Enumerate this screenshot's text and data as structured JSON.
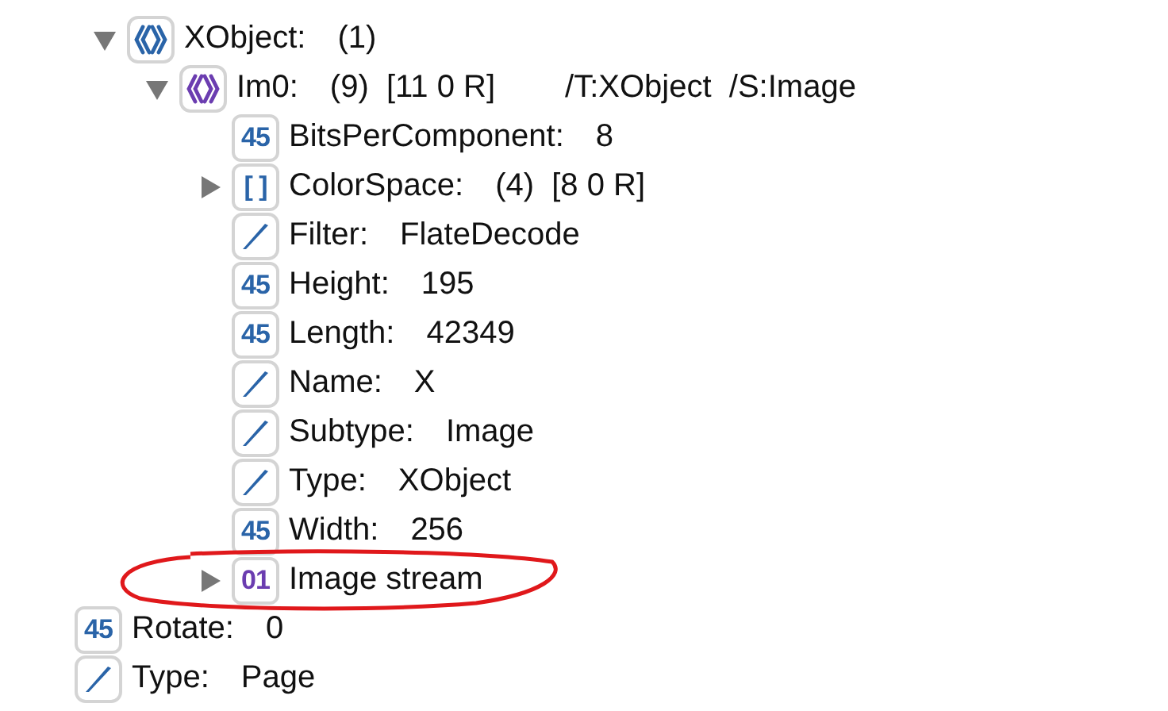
{
  "tree": [
    {
      "kind": "continuation",
      "children": [
        {
          "kind": "dict",
          "key": "XObject:",
          "value": "(1)",
          "expanded": true,
          "children": [
            {
              "kind": "stream-dict",
              "key": "Im0:",
              "value": "(9)  [11 0 R]",
              "extra": "/T:XObject  /S:Image",
              "expanded": true,
              "children": [
                {
                  "kind": "number",
                  "icon_text": "45",
                  "key": "BitsPerComponent:",
                  "value": "8"
                },
                {
                  "kind": "array",
                  "icon_text": "[ ]",
                  "key": "ColorSpace:",
                  "value": "(4)  [8 0 R]",
                  "expanded": false
                },
                {
                  "kind": "name",
                  "key": "Filter:",
                  "value": "FlateDecode"
                },
                {
                  "kind": "number",
                  "icon_text": "45",
                  "key": "Height:",
                  "value": "195"
                },
                {
                  "kind": "number",
                  "icon_text": "45",
                  "key": "Length:",
                  "value": "42349"
                },
                {
                  "kind": "name",
                  "key": "Name:",
                  "value": "X"
                },
                {
                  "kind": "name",
                  "key": "Subtype:",
                  "value": "Image"
                },
                {
                  "kind": "name",
                  "key": "Type:",
                  "value": "XObject"
                },
                {
                  "kind": "number",
                  "icon_text": "45",
                  "key": "Width:",
                  "value": "256"
                },
                {
                  "kind": "stream",
                  "icon_text": "01",
                  "key": "Image stream",
                  "expanded": false,
                  "circled": true
                }
              ]
            }
          ]
        }
      ]
    },
    {
      "kind": "number",
      "icon_text": "45",
      "key": "Rotate:",
      "value": "0"
    },
    {
      "kind": "name",
      "key": "Type:",
      "value": "Page"
    }
  ]
}
